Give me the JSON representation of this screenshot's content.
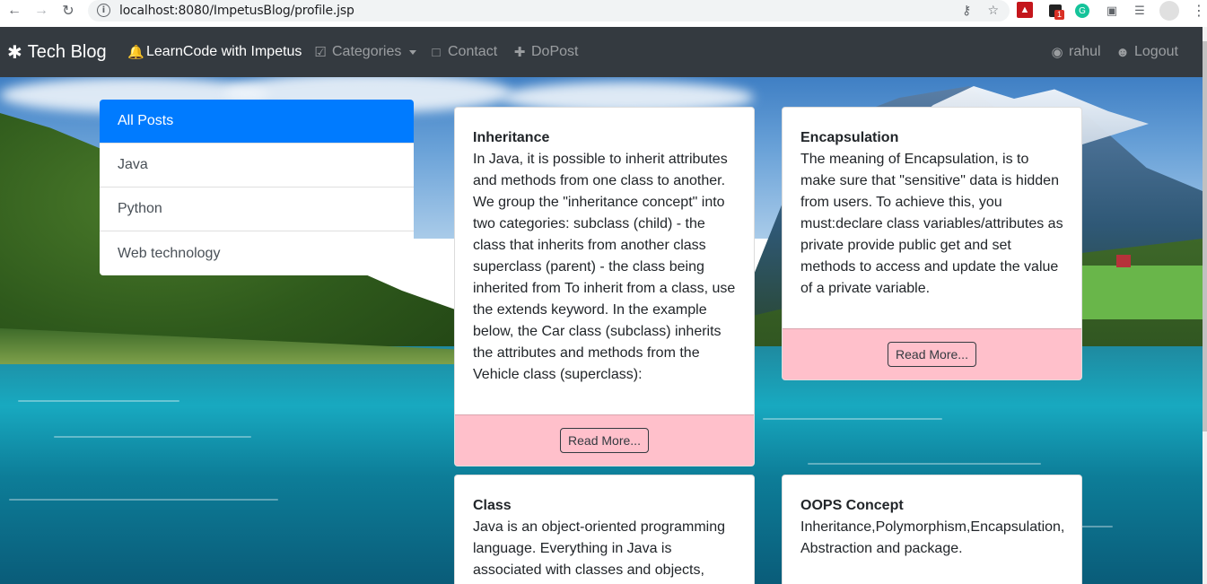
{
  "browser": {
    "url": "localhost:8080/ImpetusBlog/profile.jsp",
    "ext_badge": "1"
  },
  "navbar": {
    "brand": "Tech Blog",
    "items": [
      {
        "label": "LearnCode with Impetus"
      },
      {
        "label": "Categories"
      },
      {
        "label": "Contact"
      },
      {
        "label": "DoPost"
      }
    ],
    "user": "rahul",
    "logout": "Logout"
  },
  "categories": [
    {
      "label": "All Posts",
      "active": true
    },
    {
      "label": "Java"
    },
    {
      "label": "Python"
    },
    {
      "label": "Web technology"
    }
  ],
  "posts": [
    {
      "title": "Inheritance",
      "content": "In Java, it is possible to inherit attributes and methods from one class to another. We group the \"inheritance concept\" into two categories: subclass (child) - the class that inherits from another class superclass (parent) - the class being inherited from To inherit from a class, use the extends keyword. In the example below, the Car class (subclass) inherits the attributes and methods from the Vehicle class (superclass):",
      "button": "Read More..."
    },
    {
      "title": "Encapsulation",
      "content": "The meaning of Encapsulation, is to make sure that \"sensitive\" data is hidden from users. To achieve this, you must:declare class variables/attributes as private provide public get and set methods to access and update the value of a private variable.",
      "button": "Read More..."
    },
    {
      "title": "Class",
      "content": "Java is an object-oriented programming language. Everything in Java is associated with classes and objects, along with its"
    },
    {
      "title": "OOPS Concept",
      "content": "Inheritance,Polymorphism,Encapsulation, Abstraction and package."
    }
  ]
}
